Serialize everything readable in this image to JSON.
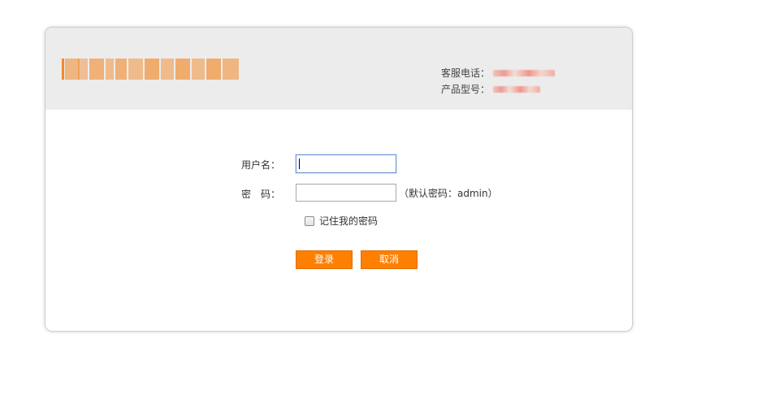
{
  "header": {
    "brand": {
      "name": "PHICOMM",
      "color": "#f28a2a"
    },
    "support_label": "客服电话：",
    "model_label": "产品型号："
  },
  "form": {
    "username_label": "用户名：",
    "password_label": "密　码：",
    "username_value": "",
    "password_value": "",
    "password_hint": "（默认密码：admin）",
    "remember_label": "记住我的密码",
    "remember_checked": false,
    "login_label": "登录",
    "cancel_label": "取消"
  },
  "colors": {
    "header_bg": "#ececec",
    "accent": "#ff7f00",
    "focus_border": "#6b96d6"
  }
}
